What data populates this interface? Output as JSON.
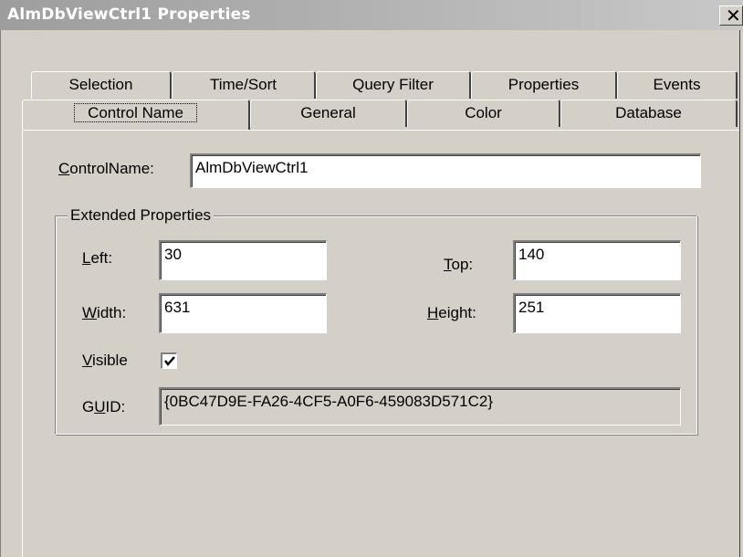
{
  "window": {
    "title": "AlmDbViewCtrl1 Properties",
    "close_glyph": "✕"
  },
  "tabs_row1": [
    "Selection",
    "Time/Sort",
    "Query Filter",
    "Properties",
    "Events"
  ],
  "tabs_row2": [
    "Control Name",
    "General",
    "Color",
    "Database"
  ],
  "active_tab": "Control Name",
  "control_name": {
    "label_u": "C",
    "label_rest": "ontrolName:",
    "value": "AlmDbViewCtrl1"
  },
  "extended": {
    "title": "Extended Properties",
    "left": {
      "label_u": "L",
      "label_rest": "eft:",
      "value": "30"
    },
    "top": {
      "label_u": "T",
      "label_rest": "op:",
      "value": "140"
    },
    "width": {
      "label_u": "W",
      "label_rest": "idth:",
      "value": "631"
    },
    "height": {
      "label_u": "H",
      "label_rest": "eight:",
      "value": "251"
    },
    "visible": {
      "label_u": "V",
      "label_rest": "isible",
      "checked": true
    },
    "guid": {
      "label_pre": "G",
      "label_u": "U",
      "label_post": "ID:",
      "value": "{0BC47D9E-FA26-4CF5-A0F6-459083D571C2}"
    }
  }
}
